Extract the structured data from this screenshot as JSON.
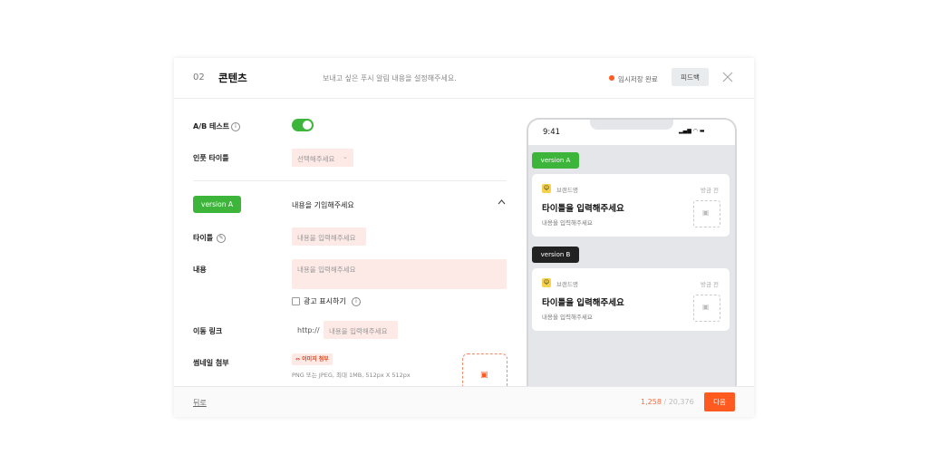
{
  "header": {
    "step": "02",
    "title": "콘텐츠",
    "description": "보내고 싶은 푸시 알림 내용을 설정해주세요.",
    "save_status": "임시저장 완료",
    "feedback_label": "피드백",
    "close_icon": "close-icon",
    "status_color": "#ff5a1f"
  },
  "form": {
    "ab_test_label": "A/B 테스트",
    "ab_test_enabled": true,
    "inapp_title_label": "인풋 타이틀",
    "inapp_title_select": "선택해주세요",
    "version_a": {
      "badge": "version A",
      "summary": "내용을 기입해주세요"
    },
    "title_label": "타이틀",
    "title_placeholder": "내용을 입력해주세요",
    "content_label": "내용",
    "content_placeholder": "내용을 입력해주세요",
    "ad_checkbox_label": "광고 표시하기",
    "ad_checkbox_checked": false,
    "link_label": "이동 링크",
    "link_prefix": "http://",
    "link_placeholder": "내용을 입력해주세요",
    "thumb_label": "썸네일 첨부",
    "thumb_button": "이미지 첨부",
    "thumb_hint": "PNG 또는 JPEG, 최대 1MB, 512px X 512px"
  },
  "footer": {
    "back_label": "뒤로",
    "count_current": "1,258",
    "count_total": "/ 20,376",
    "next_label": "다음"
  },
  "preview": {
    "time": "9:41",
    "status_icons": "signal-wifi-battery-icons",
    "version_a_label": "version A",
    "version_b_label": "version B",
    "brand": "브랜드명",
    "timestamp": "방금 전",
    "card_title": "타이틀을 입력해주세요",
    "card_body": "내용을 입력해주세요",
    "version_a_color": "#3db53a",
    "version_b_color": "#222222"
  }
}
